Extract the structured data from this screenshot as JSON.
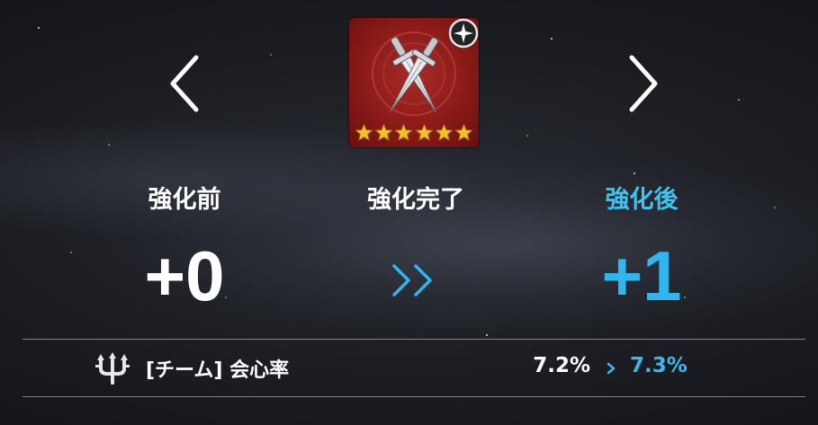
{
  "colors": {
    "accent_blue": "#3ec3f0",
    "text_white": "#ffffff",
    "card_red": "#8a1a18",
    "star_gold": "#f5c023"
  },
  "navigation": {
    "prev_icon": "chevron-left-icon",
    "next_icon": "chevron-right-icon"
  },
  "item": {
    "icon": "crossed-daggers-icon",
    "badge_icon": "sparkle-badge-icon",
    "star_count": 6
  },
  "enhance": {
    "before_label": "強化前",
    "done_label": "強化完了",
    "after_label": "強化後",
    "before_level": "+0",
    "after_level": "+1",
    "transition_icon": "double-chevron-right-icon"
  },
  "stat": {
    "icon": "trident-icon",
    "name": "[チーム] 会心率",
    "before_value": "7.2%",
    "after_value": "7.3%",
    "arrow_icon": "small-chevron-right-icon"
  }
}
